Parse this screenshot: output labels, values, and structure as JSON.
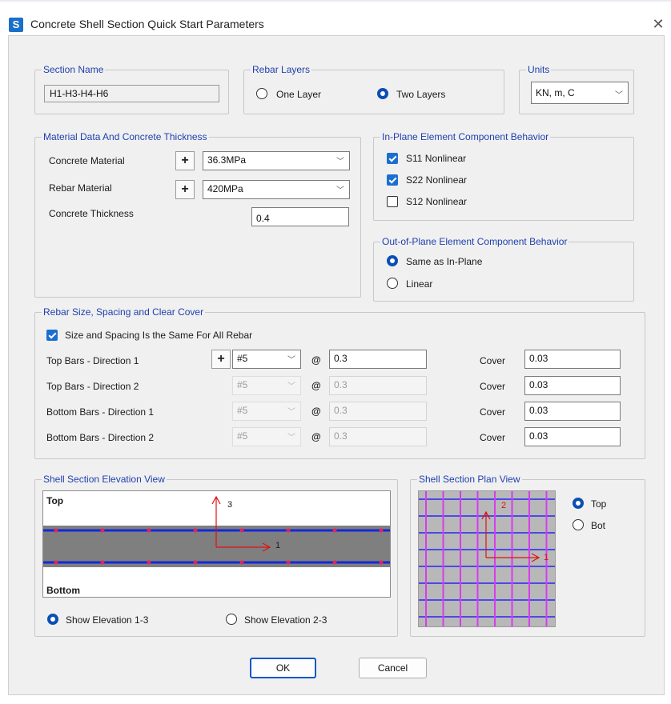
{
  "window": {
    "icon_letter": "S",
    "title": "Concrete Shell Section Quick Start Parameters",
    "close_glyph": "✕"
  },
  "section_name": {
    "legend": "Section Name",
    "value": "H1-H3-H4-H6"
  },
  "rebar_layers": {
    "legend": "Rebar Layers",
    "options": [
      "One Layer",
      "Two Layers"
    ],
    "selected": "Two Layers"
  },
  "units": {
    "legend": "Units",
    "value": "KN, m, C"
  },
  "material": {
    "legend": "Material Data And Concrete Thickness",
    "concrete_label": "Concrete Material",
    "concrete_value": "36.3MPa",
    "rebar_label": "Rebar Material",
    "rebar_value": "420MPa",
    "thickness_label": "Concrete Thickness",
    "thickness_value": "0.4",
    "plus": "+"
  },
  "inplane": {
    "legend": "In-Plane Element Component Behavior",
    "items": [
      {
        "label": "S11 Nonlinear",
        "checked": true
      },
      {
        "label": "S22 Nonlinear",
        "checked": true
      },
      {
        "label": "S12 Nonlinear",
        "checked": false
      }
    ]
  },
  "outplane": {
    "legend": "Out-of-Plane Element Component Behavior",
    "options": [
      "Same as In-Plane",
      "Linear"
    ],
    "selected": "Same as In-Plane"
  },
  "rebar": {
    "legend": "Rebar Size, Spacing and Clear Cover",
    "same_label": "Size and Spacing Is the Same For All Rebar",
    "same_checked": true,
    "at": "@",
    "cover_label": "Cover",
    "rows": [
      {
        "label": "Top Bars  -  Direction 1",
        "size": "#5",
        "spacing": "0.3",
        "cover": "0.03",
        "enabled": true
      },
      {
        "label": "Top Bars  -  Direction 2",
        "size": "#5",
        "spacing": "0.3",
        "cover": "0.03",
        "enabled": false
      },
      {
        "label": "Bottom Bars  -  Direction 1",
        "size": "#5",
        "spacing": "0.3",
        "cover": "0.03",
        "enabled": false
      },
      {
        "label": "Bottom Bars  -  Direction 2",
        "size": "#5",
        "spacing": "0.3",
        "cover": "0.03",
        "enabled": false
      }
    ]
  },
  "elevation": {
    "legend": "Shell Section Elevation View",
    "top_label": "Top",
    "bottom_label": "Bottom",
    "axis_up": "3",
    "axis_right": "1",
    "options": [
      "Show Elevation 1-3",
      "Show Elevation 2-3"
    ],
    "selected": "Show Elevation 1-3"
  },
  "plan": {
    "legend": "Shell Section Plan View",
    "axis_up": "2",
    "axis_right": "1",
    "options": [
      "Top",
      "Bot"
    ],
    "selected": "Top"
  },
  "buttons": {
    "ok": "OK",
    "cancel": "Cancel"
  },
  "colors": {
    "legend": "#1f3fae",
    "accent": "#0a4fb5",
    "rebar_line": "#1428d8",
    "rebar_dot": "#e0245e",
    "concrete": "#7f7f7f",
    "plan_bg": "#b8b8b8",
    "plan_magenta": "#d63cf0",
    "plan_blue": "#4a4ae8",
    "axis": "#e01010"
  }
}
